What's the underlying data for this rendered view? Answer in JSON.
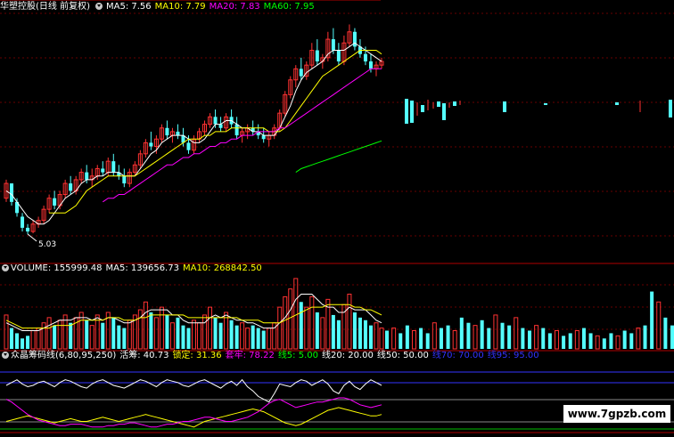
{
  "panel_main": {
    "stock_title": "华塑控股(日线 前复权)",
    "indicators": [
      {
        "label": "MA5: 7.56",
        "color": "#ffffff"
      },
      {
        "label": "MA10: 7.79",
        "color": "#ffff00"
      },
      {
        "label": "MA20: 7.83",
        "color": "#ff00ff"
      },
      {
        "label": "MA60: 7.95",
        "color": "#00ff00"
      }
    ],
    "low_marker": "5.03"
  },
  "panel_volume": {
    "indicators": [
      {
        "label": "VOLUME: 155999.48",
        "color": "#ffffff"
      },
      {
        "label": "MA5: 139656.73",
        "color": "#ffffff"
      },
      {
        "label": "MA10: 268842.50",
        "color": "#ffff00"
      }
    ]
  },
  "panel_chips": {
    "indicators": [
      {
        "label": "众晶筹码线(6,80,95,250)",
        "color": "#ffffff"
      },
      {
        "label": "活筹: 40.73",
        "color": "#ffffff"
      },
      {
        "label": "锁定: 31.36",
        "color": "#ffff00"
      },
      {
        "label": "套牢: 78.22",
        "color": "#ff00ff"
      },
      {
        "label": "线5: 5.00",
        "color": "#00ff00"
      },
      {
        "label": "线20: 20.00",
        "color": "#ffffff"
      },
      {
        "label": "线50: 50.00",
        "color": "#ffffff"
      },
      {
        "label": "线70: 70.00",
        "color": "#3333ff"
      },
      {
        "label": "线95: 95.00",
        "color": "#3333ff"
      }
    ]
  },
  "watermark": "www.7gpzb.com",
  "colors": {
    "up": "#ff3232",
    "down": "#54ffff",
    "grid": "#8b0000",
    "border": "#b00000"
  },
  "chart_data": {
    "type": "candlestick",
    "candles": [
      [
        6.0,
        6.5,
        5.9,
        6.4
      ],
      [
        6.4,
        6.4,
        5.8,
        5.9
      ],
      [
        5.9,
        6.0,
        5.5,
        5.6
      ],
      [
        5.5,
        5.6,
        5.1,
        5.2
      ],
      [
        5.2,
        5.3,
        5.03,
        5.1
      ],
      [
        5.1,
        5.4,
        5.05,
        5.3
      ],
      [
        5.3,
        5.5,
        5.2,
        5.4
      ],
      [
        5.4,
        5.8,
        5.3,
        5.7
      ],
      [
        5.7,
        6.1,
        5.6,
        6.0
      ],
      [
        6.0,
        6.2,
        5.7,
        5.8
      ],
      [
        5.8,
        6.2,
        5.7,
        6.1
      ],
      [
        6.1,
        6.5,
        6.0,
        6.4
      ],
      [
        6.4,
        6.6,
        6.1,
        6.2
      ],
      [
        6.2,
        6.6,
        6.1,
        6.5
      ],
      [
        6.5,
        6.8,
        6.4,
        6.7
      ],
      [
        6.7,
        6.9,
        6.4,
        6.5
      ],
      [
        6.5,
        6.8,
        6.3,
        6.6
      ],
      [
        6.6,
        6.9,
        6.5,
        6.8
      ],
      [
        6.8,
        7.0,
        6.6,
        6.7
      ],
      [
        6.7,
        7.1,
        6.6,
        7.0
      ],
      [
        7.0,
        7.2,
        6.6,
        6.7
      ],
      [
        6.7,
        6.9,
        6.5,
        6.6
      ],
      [
        6.6,
        6.8,
        6.3,
        6.4
      ],
      [
        6.4,
        6.8,
        6.3,
        6.7
      ],
      [
        6.7,
        7.0,
        6.6,
        6.9
      ],
      [
        6.9,
        7.3,
        6.8,
        7.2
      ],
      [
        7.2,
        7.6,
        7.1,
        7.5
      ],
      [
        7.5,
        7.8,
        7.3,
        7.4
      ],
      [
        7.4,
        7.7,
        7.2,
        7.6
      ],
      [
        7.6,
        8.0,
        7.5,
        7.9
      ],
      [
        7.9,
        8.1,
        7.6,
        7.7
      ],
      [
        7.7,
        7.9,
        7.5,
        7.8
      ],
      [
        7.8,
        8.0,
        7.6,
        7.7
      ],
      [
        7.7,
        7.9,
        7.4,
        7.5
      ],
      [
        7.5,
        7.7,
        7.2,
        7.3
      ],
      [
        7.3,
        7.7,
        7.2,
        7.6
      ],
      [
        7.6,
        7.9,
        7.5,
        7.8
      ],
      [
        7.8,
        8.1,
        7.7,
        8.0
      ],
      [
        8.0,
        8.3,
        7.9,
        8.2
      ],
      [
        8.2,
        8.4,
        7.9,
        8.0
      ],
      [
        8.0,
        8.2,
        7.8,
        7.9
      ],
      [
        7.9,
        8.3,
        7.8,
        8.2
      ],
      [
        8.2,
        8.4,
        7.9,
        8.0
      ],
      [
        8.0,
        8.2,
        7.6,
        7.7
      ],
      [
        7.7,
        7.9,
        7.5,
        7.8
      ],
      [
        7.8,
        8.0,
        7.6,
        7.9
      ],
      [
        7.9,
        8.1,
        7.7,
        7.8
      ],
      [
        7.8,
        8.0,
        7.6,
        7.7
      ],
      [
        7.7,
        7.9,
        7.5,
        7.6
      ],
      [
        7.6,
        7.8,
        7.4,
        7.7
      ],
      [
        7.7,
        8.0,
        7.6,
        7.9
      ],
      [
        7.9,
        8.4,
        7.8,
        8.3
      ],
      [
        8.3,
        8.9,
        8.2,
        8.8
      ],
      [
        8.8,
        9.3,
        8.7,
        9.2
      ],
      [
        9.2,
        9.6,
        9.0,
        9.5
      ],
      [
        9.5,
        9.8,
        9.2,
        9.3
      ],
      [
        9.3,
        9.7,
        9.2,
        9.6
      ],
      [
        9.6,
        10.2,
        9.5,
        10.0
      ],
      [
        10.0,
        10.3,
        9.6,
        9.7
      ],
      [
        9.7,
        9.9,
        9.5,
        9.8
      ],
      [
        9.8,
        10.5,
        9.7,
        10.3
      ],
      [
        10.3,
        10.6,
        9.9,
        10.0
      ],
      [
        10.0,
        10.2,
        9.6,
        9.7
      ],
      [
        9.7,
        10.4,
        9.6,
        10.2
      ],
      [
        10.2,
        10.7,
        10.1,
        10.5
      ],
      [
        10.5,
        10.6,
        10.0,
        10.1
      ],
      [
        10.1,
        10.3,
        9.8,
        9.9
      ],
      [
        9.9,
        10.1,
        9.6,
        9.7
      ],
      [
        9.7,
        9.9,
        9.4,
        9.5
      ],
      [
        9.5,
        9.7,
        9.3,
        9.6
      ],
      [
        9.6,
        9.8,
        9.5,
        9.7
      ]
    ],
    "ma5": [
      6.2,
      6.1,
      5.9,
      5.7,
      5.5,
      5.4,
      5.3,
      5.3,
      5.4,
      5.6,
      5.8,
      6.0,
      6.1,
      6.2,
      6.4,
      6.5,
      6.5,
      6.6,
      6.6,
      6.7,
      6.7,
      6.7,
      6.6,
      6.6,
      6.6,
      6.8,
      7.0,
      7.2,
      7.3,
      7.5,
      7.6,
      7.7,
      7.7,
      7.7,
      7.6,
      7.5,
      7.5,
      7.6,
      7.8,
      8.0,
      8.0,
      8.1,
      8.1,
      8.0,
      7.9,
      7.9,
      7.8,
      7.8,
      7.7,
      7.7,
      7.7,
      7.9,
      8.2,
      8.5,
      8.9,
      9.2,
      9.4,
      9.5,
      9.6,
      9.7,
      9.9,
      10.0,
      10.0,
      10.0,
      10.1,
      10.2,
      10.1,
      10.0,
      9.9,
      9.8,
      9.7
    ],
    "ma10": [
      null,
      null,
      null,
      null,
      null,
      null,
      null,
      null,
      5.6,
      5.6,
      5.6,
      5.6,
      5.7,
      5.8,
      6.0,
      6.2,
      6.3,
      6.4,
      6.5,
      6.6,
      6.6,
      6.6,
      6.6,
      6.6,
      6.6,
      6.7,
      6.8,
      6.9,
      7.0,
      7.1,
      7.2,
      7.3,
      7.4,
      7.5,
      7.6,
      7.6,
      7.6,
      7.7,
      7.7,
      7.8,
      7.8,
      7.8,
      7.9,
      7.9,
      7.9,
      7.9,
      7.9,
      7.9,
      7.9,
      7.8,
      7.8,
      7.8,
      7.9,
      8.1,
      8.3,
      8.5,
      8.7,
      8.9,
      9.1,
      9.3,
      9.4,
      9.5,
      9.6,
      9.7,
      9.8,
      9.9,
      10.0,
      10.0,
      10.0,
      10.0,
      9.9
    ],
    "ma20": [
      null,
      null,
      null,
      null,
      null,
      null,
      null,
      null,
      null,
      null,
      null,
      null,
      null,
      null,
      null,
      null,
      null,
      null,
      5.9,
      6.0,
      6.0,
      6.1,
      6.1,
      6.2,
      6.3,
      6.4,
      6.5,
      6.6,
      6.7,
      6.8,
      6.9,
      6.9,
      7.0,
      7.1,
      7.1,
      7.2,
      7.2,
      7.3,
      7.4,
      7.4,
      7.5,
      7.5,
      7.6,
      7.6,
      7.7,
      7.7,
      7.7,
      7.8,
      7.8,
      7.8,
      7.8,
      7.9,
      7.9,
      8.0,
      8.1,
      8.2,
      8.3,
      8.4,
      8.5,
      8.6,
      8.7,
      8.8,
      8.9,
      9.0,
      9.1,
      9.2,
      9.3,
      9.4,
      9.5,
      9.5,
      9.5
    ],
    "ma60": [
      null,
      null,
      null,
      null,
      null,
      null,
      null,
      null,
      null,
      null,
      null,
      null,
      null,
      null,
      null,
      null,
      null,
      null,
      null,
      null,
      null,
      null,
      null,
      null,
      null,
      null,
      null,
      null,
      null,
      null,
      null,
      null,
      null,
      null,
      null,
      null,
      null,
      null,
      null,
      null,
      null,
      null,
      null,
      null,
      null,
      null,
      null,
      null,
      null,
      null,
      null,
      null,
      null,
      null,
      6.7,
      6.8,
      6.85,
      6.9,
      6.95,
      7.0,
      7.05,
      7.1,
      7.15,
      7.2,
      7.25,
      7.3,
      7.35,
      7.4,
      7.45,
      7.5,
      7.55
    ],
    "volume": [
      13,
      8,
      6,
      4,
      5,
      7,
      8,
      10,
      12,
      9,
      11,
      13,
      10,
      12,
      14,
      11,
      9,
      13,
      10,
      14,
      12,
      9,
      8,
      11,
      13,
      15,
      18,
      14,
      12,
      16,
      13,
      10,
      12,
      9,
      8,
      11,
      10,
      13,
      16,
      12,
      10,
      14,
      11,
      9,
      10,
      8,
      9,
      8,
      7,
      8,
      10,
      16,
      20,
      23,
      27,
      18,
      16,
      20,
      14,
      12,
      19,
      13,
      11,
      17,
      21,
      14,
      12,
      11,
      9,
      10,
      8
    ],
    "volume_tail": [
      7,
      8,
      6,
      9,
      7,
      8,
      6,
      10,
      8,
      9,
      7,
      12,
      10,
      9,
      11,
      8,
      13,
      10,
      9,
      12,
      8,
      7,
      9,
      8,
      6,
      7,
      5,
      6,
      7,
      8,
      6,
      5,
      4,
      6,
      5,
      7,
      6,
      8,
      9,
      22,
      18,
      12,
      9
    ],
    "vol_ma5": [
      10,
      9,
      8,
      7,
      7,
      7,
      7,
      8,
      9,
      10,
      11,
      11,
      11,
      12,
      12,
      12,
      11,
      12,
      11,
      12,
      12,
      11,
      10,
      10,
      11,
      12,
      14,
      15,
      15,
      15,
      15,
      13,
      13,
      11,
      10,
      10,
      10,
      10,
      12,
      13,
      12,
      13,
      12,
      11,
      11,
      10,
      10,
      9,
      8,
      8,
      8,
      10,
      12,
      15,
      19,
      21,
      21,
      21,
      19,
      17,
      16,
      16,
      14,
      14,
      16,
      15,
      15,
      15,
      13,
      11,
      10
    ],
    "vol_ma10": [
      11,
      10,
      9,
      8,
      8,
      8,
      8,
      8,
      8,
      9,
      9,
      9,
      9,
      10,
      11,
      11,
      11,
      11,
      11,
      12,
      12,
      12,
      11,
      11,
      11,
      12,
      12,
      13,
      13,
      13,
      13,
      13,
      13,
      13,
      12,
      12,
      12,
      12,
      12,
      12,
      12,
      12,
      12,
      12,
      11,
      11,
      11,
      11,
      10,
      10,
      10,
      10,
      11,
      12,
      13,
      14,
      15,
      16,
      16,
      16,
      17,
      17,
      17,
      17,
      17,
      16,
      16,
      15,
      15,
      14,
      13
    ],
    "chips_active": [
      34,
      36,
      38,
      35,
      33,
      34,
      36,
      37,
      35,
      33,
      36,
      38,
      37,
      35,
      33,
      32,
      35,
      37,
      38,
      36,
      34,
      33,
      32,
      34,
      36,
      38,
      37,
      35,
      33,
      36,
      38,
      37,
      36,
      34,
      33,
      35,
      37,
      38,
      36,
      34,
      32,
      35,
      37,
      34,
      38,
      33,
      30,
      26,
      24,
      22,
      28,
      35,
      34,
      33,
      36,
      38,
      37,
      34,
      36,
      38,
      35,
      30,
      28,
      34,
      37,
      33,
      31,
      35,
      38,
      36,
      34
    ],
    "chips_lock": [
      8,
      9,
      10,
      11,
      12,
      11,
      10,
      9,
      8,
      7,
      8,
      9,
      10,
      9,
      8,
      8,
      9,
      10,
      11,
      10,
      9,
      8,
      9,
      10,
      11,
      12,
      13,
      12,
      11,
      10,
      9,
      8,
      7,
      6,
      5,
      4,
      6,
      8,
      9,
      10,
      11,
      12,
      13,
      14,
      15,
      16,
      17,
      16,
      15,
      13,
      11,
      9,
      7,
      6,
      5,
      6,
      8,
      10,
      12,
      14,
      16,
      17,
      18,
      17,
      16,
      15,
      14,
      13,
      12,
      12,
      13
    ],
    "chips_trap": [
      24,
      22,
      19,
      16,
      13,
      11,
      9,
      8,
      7,
      6,
      5,
      5,
      6,
      6,
      6,
      5,
      4,
      4,
      4,
      5,
      5,
      6,
      6,
      7,
      7,
      6,
      5,
      4,
      4,
      5,
      6,
      6,
      7,
      8,
      8,
      9,
      10,
      11,
      11,
      10,
      9,
      8,
      8,
      9,
      10,
      11,
      13,
      15,
      18,
      21,
      23,
      24,
      22,
      20,
      18,
      19,
      20,
      21,
      22,
      22,
      23,
      24,
      25,
      25,
      24,
      22,
      20,
      19,
      18,
      19,
      20
    ]
  }
}
